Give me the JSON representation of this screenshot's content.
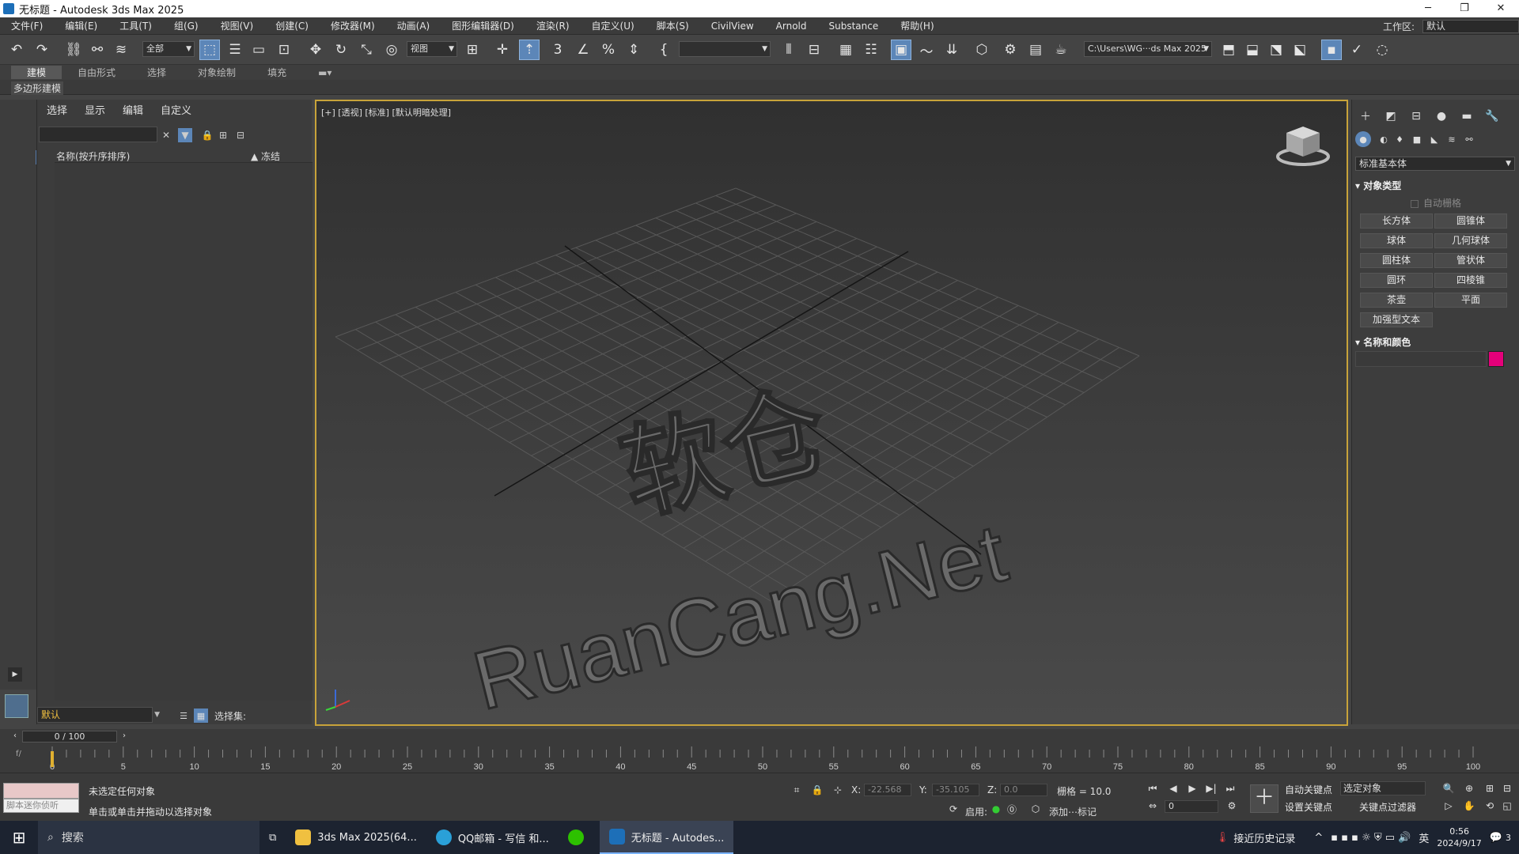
{
  "window": {
    "title": "无标题 - Autodesk 3ds Max 2025",
    "minimize": "─",
    "restore": "❐",
    "close": "✕"
  },
  "menu": {
    "items": [
      "文件(F)",
      "编辑(E)",
      "工具(T)",
      "组(G)",
      "视图(V)",
      "创建(C)",
      "修改器(M)",
      "动画(A)",
      "图形编辑器(D)",
      "渲染(R)",
      "自定义(U)",
      "脚本(S)",
      "CivilView",
      "Arnold",
      "Substance",
      "帮助(H)"
    ],
    "workspace_label": "工作区:",
    "workspace_value": "默认"
  },
  "toolbar": {
    "selection_filter": "全部",
    "ref_coord": "视图",
    "named_selection": "",
    "project_path": "C:\\Users\\WG···ds Max 2025"
  },
  "ribbon": {
    "tabs": [
      "建模",
      "自由形式",
      "选择",
      "对象绘制",
      "填充"
    ],
    "sub": "多边形建模"
  },
  "scene_explorer": {
    "menu": [
      "选择",
      "显示",
      "编辑",
      "自定义"
    ],
    "col_name": "名称(按升序排序)",
    "col_frozen": "▲ 冻结",
    "layer": "默认",
    "selection_set_label": "选择集:"
  },
  "viewport": {
    "label": "[+] [透视] [标准] [默认明暗处理]",
    "watermark_top": "软仓",
    "watermark_bottom": "RuanCang.Net"
  },
  "command_panel": {
    "category": "标准基本体",
    "rollout_object_type": "对象类型",
    "autogrid": "自动栅格",
    "buttons": [
      "长方体",
      "圆锥体",
      "球体",
      "几何球体",
      "圆柱体",
      "管状体",
      "圆环",
      "四棱锥",
      "茶壶",
      "平面",
      "加强型文本"
    ],
    "rollout_name_color": "名称和颜色",
    "object_color": "#e5007a"
  },
  "timeline": {
    "frame_display": "0 / 100",
    "tick_labels": [
      "0",
      "5",
      "10",
      "15",
      "20",
      "25",
      "30",
      "35",
      "40",
      "45",
      "50",
      "55",
      "60",
      "65",
      "70",
      "75",
      "80",
      "85",
      "90",
      "95",
      "100"
    ]
  },
  "status": {
    "maxscript_hint": "脚本迷你侦听",
    "line1": "未选定任何对象",
    "line2": "单击或单击并拖动以选择对象",
    "x_label": "X:",
    "x_value": "-22.568",
    "y_label": "Y:",
    "y_value": "-35.105",
    "z_label": "Z:",
    "z_value": "0.0",
    "grid": "栅格 = 10.0",
    "enable": "启用:",
    "add_tag": "添加⋯标记",
    "auto_key": "自动关键点",
    "set_key": "设置关键点",
    "key_mode": "选定对象",
    "key_filters": "关键点过滤器",
    "frame": "0"
  },
  "taskbar": {
    "search": "搜索",
    "tasks": [
      "3ds Max 2025(64...",
      "QQ邮箱 - 写信 和...",
      "无标题 - Autodes..."
    ],
    "weather": "接近历史记录",
    "ime": "英",
    "time": "0:56",
    "date": "2024/9/17",
    "notifications": "3"
  }
}
